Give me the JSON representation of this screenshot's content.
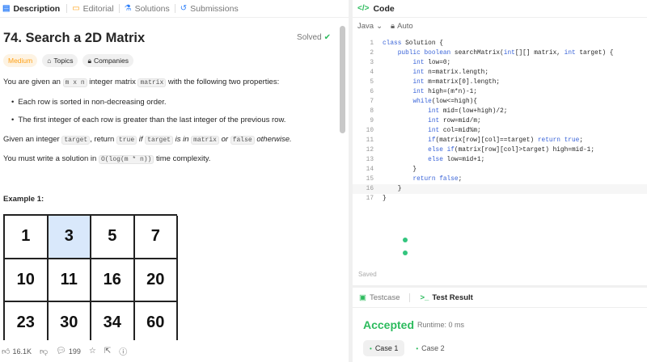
{
  "tabs": [
    {
      "icon": "description-icon",
      "glyph": "▤",
      "label": "Description",
      "active": true
    },
    {
      "icon": "editorial-icon",
      "glyph": "▭",
      "label": "Editorial"
    },
    {
      "icon": "solutions-icon",
      "glyph": "⚗",
      "label": "Solutions"
    },
    {
      "icon": "submissions-icon",
      "glyph": "↺",
      "label": "Submissions"
    }
  ],
  "problem": {
    "title": "74. Search a 2D Matrix",
    "status": "Solved",
    "difficulty": "Medium",
    "topics_label": "Topics",
    "companies_label": "Companies",
    "intro_a": "You are given an",
    "intro_code1": "m x n",
    "intro_b": "integer matrix",
    "intro_code2": "matrix",
    "intro_c": "with the following two properties:",
    "bullet1": "Each row is sorted in non-decreasing order.",
    "bullet2": "The first integer of each row is greater than the last integer of the previous row.",
    "given_a": "Given an integer",
    "given_code1": "target",
    "given_b": ", return",
    "given_code2": "true",
    "given_c": "if",
    "given_code3": "target",
    "given_d": "is in",
    "given_code4": "matrix",
    "given_e": "or",
    "given_code5": "false",
    "given_f": "otherwise.",
    "must_a": "You must write a solution in",
    "must_code": "O(log(m * n))",
    "must_b": "time complexity.",
    "example_title": "Example 1:",
    "matrix": [
      [
        "1",
        "3",
        "5",
        "7"
      ],
      [
        "10",
        "11",
        "16",
        "20"
      ],
      [
        "23",
        "30",
        "34",
        "60"
      ]
    ],
    "highlighted_value": "3"
  },
  "bottom_bar": {
    "likes": "16.1K",
    "comments": "199"
  },
  "code_panel": {
    "title": "Code",
    "language": "Java",
    "mode": "Auto",
    "saved_label": "Saved",
    "lines": [
      "class Solution {",
      "    public boolean searchMatrix(int[][] matrix, int target) {",
      "        int low=0;",
      "        int n=matrix.length;",
      "        int m=matrix[0].length;",
      "        int high=(m*n)-1;",
      "        while(low<=high){",
      "            int mid=(low+high)/2;",
      "            int row=mid/m;",
      "            int col=mid%m;",
      "            if(matrix[row][col]==target) return true;",
      "            else if(matrix[row][col]>target) high=mid-1;",
      "            else low=mid+1;",
      "        }",
      "        return false;",
      "    }",
      "}"
    ]
  },
  "result_panel": {
    "testcase_label": "Testcase",
    "test_result_label": "Test Result",
    "verdict": "Accepted",
    "runtime": "Runtime: 0 ms",
    "cases": [
      "Case 1",
      "Case 2"
    ]
  },
  "colors": {
    "accent_green": "#2cbb5d",
    "medium": "#ffa116",
    "highlight_cell": "#d9e8fb"
  }
}
